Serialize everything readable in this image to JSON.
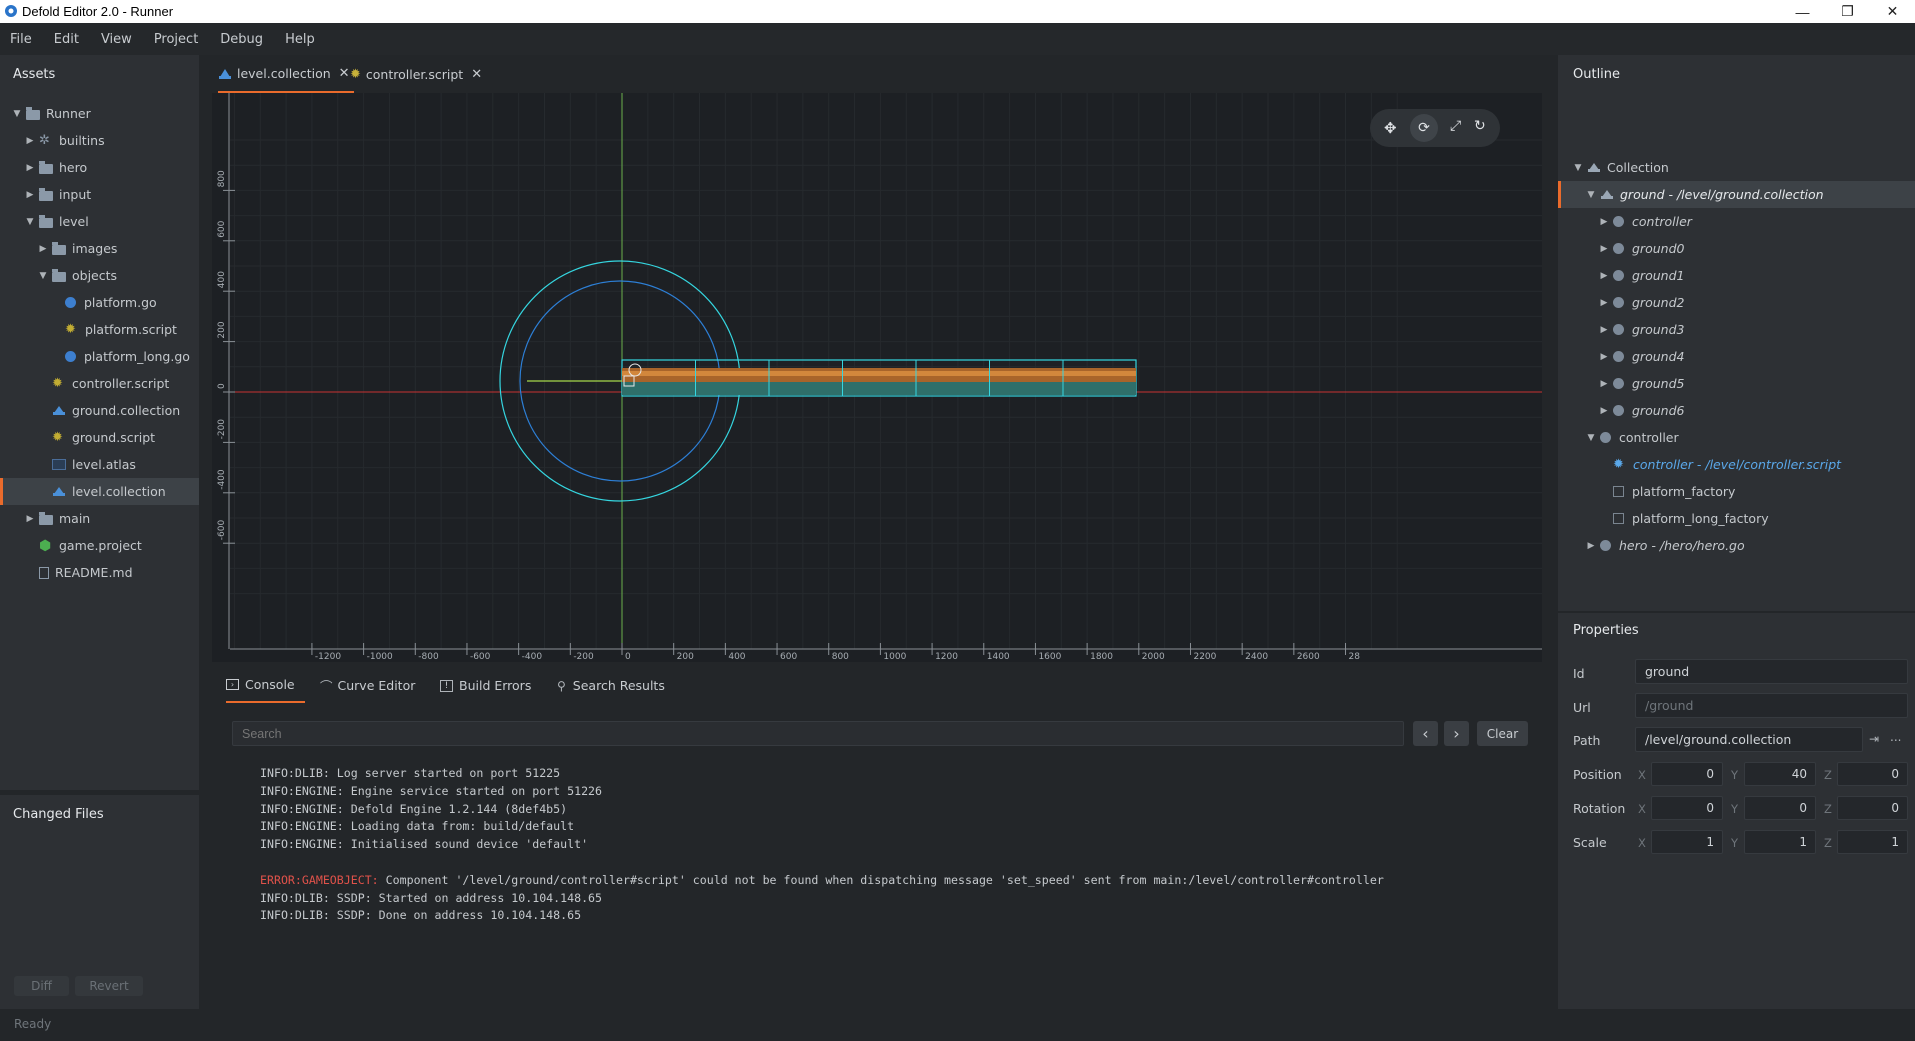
{
  "window": {
    "title": "Defold Editor 2.0 - Runner",
    "minimize": "—",
    "maximize": "❐",
    "close": "✕"
  },
  "menu": [
    "File",
    "Edit",
    "View",
    "Project",
    "Debug",
    "Help"
  ],
  "assets": {
    "title": "Assets",
    "items": [
      {
        "label": "Runner",
        "depth": 0,
        "expander": "open",
        "icon": "folder-icon"
      },
      {
        "label": "builtins",
        "depth": 1,
        "expander": "closed",
        "icon": "gear-folder-icon"
      },
      {
        "label": "hero",
        "depth": 1,
        "expander": "closed",
        "icon": "folder-icon"
      },
      {
        "label": "input",
        "depth": 1,
        "expander": "closed",
        "icon": "folder-icon"
      },
      {
        "label": "level",
        "depth": 1,
        "expander": "open",
        "icon": "folder-icon"
      },
      {
        "label": "images",
        "depth": 2,
        "expander": "closed",
        "icon": "folder-icon"
      },
      {
        "label": "objects",
        "depth": 2,
        "expander": "open",
        "icon": "folder-icon"
      },
      {
        "label": "platform.go",
        "depth": 3,
        "expander": "none",
        "icon": "game-object-icon"
      },
      {
        "label": "platform.script",
        "depth": 3,
        "expander": "none",
        "icon": "script-gear-icon"
      },
      {
        "label": "platform_long.go",
        "depth": 3,
        "expander": "none",
        "icon": "game-object-icon"
      },
      {
        "label": "controller.script",
        "depth": 2,
        "expander": "none",
        "icon": "script-gear-icon"
      },
      {
        "label": "ground.collection",
        "depth": 2,
        "expander": "none",
        "icon": "collection-icon"
      },
      {
        "label": "ground.script",
        "depth": 2,
        "expander": "none",
        "icon": "script-gear-icon"
      },
      {
        "label": "level.atlas",
        "depth": 2,
        "expander": "none",
        "icon": "atlas-icon"
      },
      {
        "label": "level.collection",
        "depth": 2,
        "expander": "none",
        "icon": "collection-icon",
        "selected": true
      },
      {
        "label": "main",
        "depth": 1,
        "expander": "closed",
        "icon": "folder-icon"
      },
      {
        "label": "game.project",
        "depth": 1,
        "expander": "none",
        "icon": "project-icon"
      },
      {
        "label": "README.md",
        "depth": 1,
        "expander": "none",
        "icon": "file-icon"
      }
    ]
  },
  "changed_files": {
    "title": "Changed Files",
    "diff": "Diff",
    "revert": "Revert"
  },
  "editor_tabs": [
    {
      "label": "level.collection",
      "icon": "collection-icon",
      "active": true
    },
    {
      "label": "controller.script",
      "icon": "script-gear-icon",
      "active": false
    }
  ],
  "scene": {
    "x_ticks": [
      "-1200",
      "-1000",
      "-800",
      "-600",
      "-400",
      "-200",
      "0",
      "200",
      "400",
      "600",
      "800",
      "1000",
      "1200",
      "1400",
      "1600",
      "1800",
      "2000",
      "2200",
      "2400",
      "2600",
      "28"
    ],
    "y_ticks": [
      "800",
      "600",
      "400",
      "200",
      "0",
      "-200",
      "-400",
      "-600"
    ],
    "tools": [
      "move-tool-icon",
      "rotate-tool-icon",
      "scale-tool-icon",
      "camera-tool-icon"
    ],
    "colors": {
      "x_axis": "#c83232",
      "y_axis": "#6ab04c",
      "selection": "#35d6e0",
      "collision": "#2d7fd6"
    }
  },
  "bottom_tabs": [
    {
      "label": "Console",
      "icon": "console-icon",
      "active": true
    },
    {
      "label": "Curve Editor",
      "icon": "curve-icon",
      "active": false
    },
    {
      "label": "Build Errors",
      "icon": "error-icon",
      "active": false
    },
    {
      "label": "Search Results",
      "icon": "search-icon",
      "active": false
    }
  ],
  "console": {
    "search_placeholder": "Search",
    "prev": "‹",
    "next": "›",
    "clear": "Clear",
    "lines": [
      {
        "prefix": "",
        "text": "INFO:DLIB: Log server started on port 51225"
      },
      {
        "prefix": "",
        "text": "INFO:ENGINE: Engine service started on port 51226"
      },
      {
        "prefix": "",
        "text": "INFO:ENGINE: Defold Engine 1.2.144 (8def4b5)"
      },
      {
        "prefix": "",
        "text": "INFO:ENGINE: Loading data from: build/default"
      },
      {
        "prefix": "",
        "text": "INFO:ENGINE: Initialised sound device 'default'"
      },
      {
        "prefix": "",
        "text": " "
      },
      {
        "prefix": "ERROR:GAMEOBJECT:",
        "text": " Component '/level/ground/controller#script' could not be found when dispatching message 'set_speed' sent from main:/level/controller#controller"
      },
      {
        "prefix": "",
        "text": "INFO:DLIB: SSDP: Started on address 10.104.148.65"
      },
      {
        "prefix": "",
        "text": "INFO:DLIB: SSDP: Done on address 10.104.148.65"
      }
    ]
  },
  "outline": {
    "title": "Outline",
    "items": [
      {
        "label": "Collection",
        "depth": 0,
        "expander": "open",
        "icon": "collection-icon",
        "italic": false
      },
      {
        "label": "ground - /level/ground.collection",
        "depth": 1,
        "expander": "open",
        "icon": "collection-icon",
        "italic": true,
        "selected": true
      },
      {
        "label": "controller",
        "depth": 2,
        "expander": "closed",
        "icon": "game-object-icon",
        "italic": true
      },
      {
        "label": "ground0",
        "depth": 2,
        "expander": "closed",
        "icon": "game-object-icon",
        "italic": true
      },
      {
        "label": "ground1",
        "depth": 2,
        "expander": "closed",
        "icon": "game-object-icon",
        "italic": true
      },
      {
        "label": "ground2",
        "depth": 2,
        "expander": "closed",
        "icon": "game-object-icon",
        "italic": true
      },
      {
        "label": "ground3",
        "depth": 2,
        "expander": "closed",
        "icon": "game-object-icon",
        "italic": true
      },
      {
        "label": "ground4",
        "depth": 2,
        "expander": "closed",
        "icon": "game-object-icon",
        "italic": true
      },
      {
        "label": "ground5",
        "depth": 2,
        "expander": "closed",
        "icon": "game-object-icon",
        "italic": true
      },
      {
        "label": "ground6",
        "depth": 2,
        "expander": "closed",
        "icon": "game-object-icon",
        "italic": true
      },
      {
        "label": "controller",
        "depth": 1,
        "expander": "open",
        "icon": "game-object-icon",
        "italic": false
      },
      {
        "label": "controller - /level/controller.script",
        "depth": 2,
        "expander": "none",
        "icon": "script-gear-icon",
        "italic": true,
        "highlight": true
      },
      {
        "label": "platform_factory",
        "depth": 2,
        "expander": "none",
        "icon": "factory-icon",
        "italic": false
      },
      {
        "label": "platform_long_factory",
        "depth": 2,
        "expander": "none",
        "icon": "factory-icon",
        "italic": false
      },
      {
        "label": "hero - /hero/hero.go",
        "depth": 1,
        "expander": "closed",
        "icon": "game-object-icon",
        "italic": true
      }
    ]
  },
  "properties": {
    "title": "Properties",
    "id_label": "Id",
    "id_value": "ground",
    "url_label": "Url",
    "url_value": "/ground",
    "path_label": "Path",
    "path_value": "/level/ground.collection",
    "path_goto": "⇥",
    "path_more": "...",
    "position_label": "Position",
    "position": {
      "x": "0",
      "y": "40",
      "z": "0"
    },
    "rotation_label": "Rotation",
    "rotation": {
      "x": "0",
      "y": "0",
      "z": "0"
    },
    "scale_label": "Scale",
    "scale": {
      "x": "1",
      "y": "1",
      "z": "1"
    },
    "axis_x": "X",
    "axis_y": "Y",
    "axis_z": "Z"
  },
  "status": {
    "text": "Ready"
  }
}
